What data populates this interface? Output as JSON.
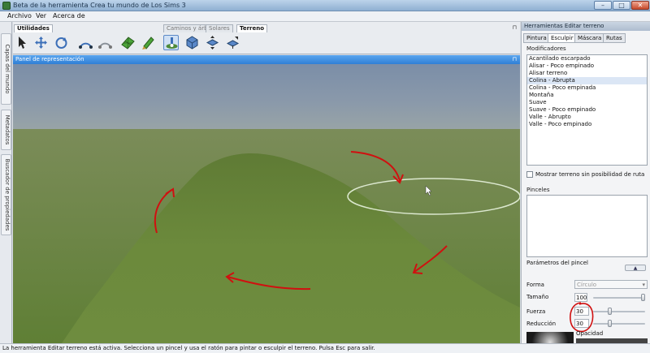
{
  "window": {
    "title": "Beta de la herramienta Crea tu mundo de Los Sims 3",
    "minimize": "–",
    "maximize": "□",
    "close": "✕"
  },
  "menu": [
    "Archivo",
    "Ver",
    "Acerca de"
  ],
  "left_tabs": [
    "Capas del mundo",
    "Metadatos",
    "Buscador de propiedades"
  ],
  "toolbar": {
    "tabs": [
      {
        "label": "Utilidades",
        "active": true
      },
      {
        "label": "Caminos y árboles",
        "active": false
      },
      {
        "label": "Solares",
        "active": false
      },
      {
        "label": "Terreno",
        "active": true
      }
    ],
    "pin": "⊓",
    "tools": [
      "select-icon",
      "move-icon",
      "rotate-icon",
      "arc-icon",
      "path-icon",
      "grid-icon",
      "paint-icon",
      "brush-icon",
      "cube-terrain-icon",
      "raise-icon",
      "lower-icon"
    ]
  },
  "viewport": {
    "header": "Panel de representación",
    "pin": "⊓"
  },
  "status": "La herramienta Editar terreno está activa. Selecciona un pincel y usa el ratón para pintar o esculpir el terreno. Pulsa Esc para salir.",
  "right_panel": {
    "header": "Herramientas Editar terreno",
    "tabs": [
      {
        "label": "Pintura",
        "active": false
      },
      {
        "label": "Esculpir",
        "active": true
      },
      {
        "label": "Máscara",
        "active": false
      },
      {
        "label": "Rutas",
        "active": false
      }
    ],
    "modifiers_label": "Modificadores",
    "modifiers": [
      "Acantilado escarpado",
      "Alisar - Poco empinado",
      "Alisar terreno",
      "Colina - Abrupta",
      "Colina - Poco empinada",
      "Montaña",
      "Suave",
      "Suave - Poco empinado",
      "Valle - Abrupto",
      "Valle - Poco empinado"
    ],
    "selected_modifier_index": 3,
    "show_terrain_checkbox": "Mostrar terreno sin posibilidad de ruta",
    "brushes_label": "Pinceles",
    "params_title": "Parámetros del pincel",
    "shape_label": "Forma",
    "shape_value": "Círculo",
    "size_label": "Tamaño",
    "size_value": "100",
    "size_level": 1.0,
    "strength_label": "Fuerza",
    "strength_value": "30",
    "strength_level": 0.3,
    "falloff_label": "Reducción",
    "falloff_value": "30",
    "falloff_level": 0.3,
    "opacity_label": "Opacidad"
  },
  "colors": {
    "accent": "#2f7fd6",
    "annotation": "#d01010",
    "terrain": "#6a8a3c",
    "sky": "#7f93ad"
  }
}
